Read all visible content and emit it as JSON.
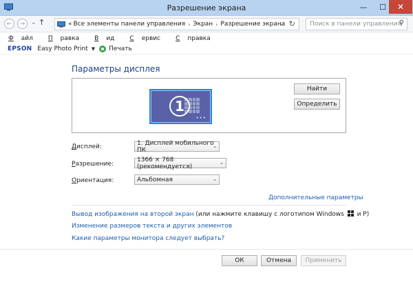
{
  "window": {
    "title": "Разрешение экрана",
    "min_glyph": "—",
    "max_glyph": "☐",
    "close_glyph": "✕"
  },
  "nav": {
    "back_glyph": "←",
    "fwd_glyph": "→",
    "down_glyph": "⌄",
    "up_glyph": "↑",
    "crumb_prefix": "«",
    "breadcrumbs": [
      "Все элементы панели управления",
      "Экран",
      "Разрешение экрана"
    ],
    "sep_glyph": "›",
    "dropdown_glyph": "⌄",
    "refresh_glyph": "↻",
    "search_placeholder": "Поиск в панели управления",
    "search_glyph": "⚲"
  },
  "menu": {
    "file": {
      "u": "Ф",
      "rest": "айл"
    },
    "edit": {
      "u": "П",
      "rest": "равка"
    },
    "view": {
      "u": "В",
      "rest": "ид"
    },
    "service": {
      "u": "С",
      "rest": "ервис"
    },
    "help": {
      "u": "С",
      "rest": "правка"
    }
  },
  "epson": {
    "logo": "EPSON",
    "app": "Easy Photo Print",
    "dd_glyph": "▼",
    "print": "Печать"
  },
  "content": {
    "heading": "Параметры дисплея",
    "monitor_number": "1",
    "monitor_dots": "•••",
    "find_button": "Найти",
    "identify_button": "Определить",
    "display": {
      "label_u": "Д",
      "label_rest": "исплей:",
      "value": "1. Дисплей мобильного ПК"
    },
    "resolution": {
      "label_u": "Р",
      "label_rest": "азрешение:",
      "value": "1366 × 768 (рекомендуется)"
    },
    "orientation": {
      "label_u": "О",
      "label_rest": "риентация:",
      "value": "Альбомная"
    },
    "select_arrow": "⌄",
    "advanced_link": "Дополнительные параметры",
    "second_screen_link": "Вывод изображения на второй экран",
    "second_screen_note_1": " (или нажмите клавишу с логотипом Windows",
    "second_screen_note_2": " и P)",
    "text_size_link": "Изменение размеров текста и других элементов",
    "monitor_help_link": "Какие параметры монитора следует выбрать?"
  },
  "footer": {
    "ok": "ОК",
    "cancel": "Отмена",
    "apply": "Применить"
  },
  "colors": {
    "titlebar": "#b8d3f0",
    "close": "#c7463a",
    "link": "#1a5dad",
    "heading": "#1b3f85",
    "monitor": "#5a61a6",
    "monitor_border": "#2d84d8"
  }
}
